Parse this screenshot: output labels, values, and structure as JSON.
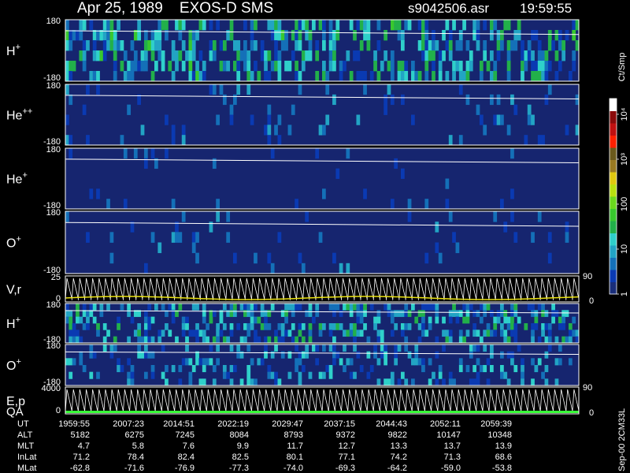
{
  "header": {
    "title": "Apr 25, 1989    EXOS-D SMS",
    "file": "s9042506.asr",
    "time": "19:59:55"
  },
  "chart_data": {
    "type": "heatmap",
    "panels": [
      {
        "id": "h_plus",
        "label": "H",
        "sup": "+",
        "ytop": "180",
        "ybot": "-180",
        "mode": "spectrogram",
        "level": 0.45
      },
      {
        "id": "he_pp",
        "label": "He",
        "sup": "++",
        "ytop": "180",
        "ybot": "-180",
        "mode": "spectrogram",
        "level": 0.08
      },
      {
        "id": "he_plus",
        "label": "He",
        "sup": "+",
        "ytop": "180",
        "ybot": "-180",
        "mode": "spectrogram",
        "level": 0.03
      },
      {
        "id": "o_plus",
        "label": "O",
        "sup": "+",
        "ytop": "180",
        "ybot": "-180",
        "mode": "spectrogram",
        "level": 0.05
      },
      {
        "id": "v_r",
        "label": "V,r",
        "sup": "",
        "ytop": "25",
        "ybot": "0",
        "rtop": "90",
        "rbot": "0",
        "mode": "trace"
      },
      {
        "id": "h_plus_2",
        "label": "H",
        "sup": "+",
        "ytop": "180",
        "ybot": "-180",
        "mode": "spectrogram",
        "level": 0.4
      },
      {
        "id": "o_plus_2",
        "label": "O",
        "sup": "+",
        "ytop": "180",
        "ybot": "-180",
        "mode": "spectrogram",
        "level": 0.25
      },
      {
        "id": "e_p",
        "label": "E,p",
        "label2": "QA",
        "sup": "",
        "ytop": "4000",
        "ybot": "0",
        "rtop": "90",
        "rbot": "0",
        "mode": "trace"
      }
    ],
    "colorbar": {
      "unit": "Ct/Smp",
      "ticks": [
        {
          "value": 1,
          "label": "1"
        },
        {
          "value": 10,
          "label": "10"
        },
        {
          "value": 100,
          "label": "100"
        },
        {
          "value": 1000,
          "label": "10³"
        },
        {
          "value": 10000,
          "label": "10⁴"
        }
      ],
      "colors": [
        "#1a2e7a",
        "#0a3ab2",
        "#1470b8",
        "#22a4c4",
        "#2fd0ca",
        "#22b04a",
        "#38c82e",
        "#6ad81e",
        "#b8e010",
        "#e0c810",
        "#9a7a22",
        "#6a5a1c",
        "#ff2000",
        "#c01010",
        "#8a0a0a",
        "#ffffff"
      ]
    },
    "ephemeris": {
      "rows": [
        {
          "label": "UT",
          "values": [
            "1959:55",
            "2007:23",
            "2014:51",
            "2022:19",
            "2029:47",
            "2037:15",
            "2044:43",
            "2052:11",
            "2059:39"
          ]
        },
        {
          "label": "ALT",
          "values": [
            "5182",
            "6275",
            "7245",
            "8084",
            "8793",
            "9372",
            "9822",
            "10147",
            "10348"
          ]
        },
        {
          "label": "MLT",
          "values": [
            "4.7",
            "5.8",
            "7.6",
            "9.9",
            "11.7",
            "12.7",
            "13.3",
            "13.7",
            "13.9"
          ]
        },
        {
          "label": "InLat",
          "values": [
            "71.2",
            "78.4",
            "82.4",
            "82.5",
            "80.1",
            "77.1",
            "74.2",
            "71.3",
            "68.6"
          ]
        },
        {
          "label": "MLat",
          "values": [
            "-62.8",
            "-71.6",
            "-76.9",
            "-77.3",
            "-74.0",
            "-69.3",
            "-64.2",
            "-59.0",
            "-53.8"
          ]
        }
      ]
    },
    "footer_note": "Sep-00 2CM33L",
    "colors": {
      "background": "#000000",
      "panel_base": "#16256f",
      "trace": "#ffffff",
      "vr_trace": "#e8e010",
      "qa_bar": "#38ff38"
    }
  }
}
